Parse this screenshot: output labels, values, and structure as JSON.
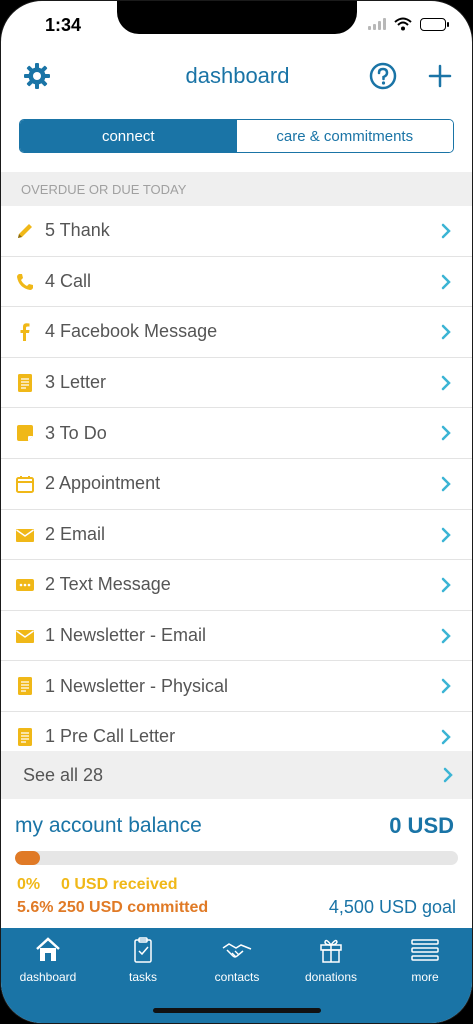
{
  "status_bar": {
    "time": "1:34"
  },
  "header": {
    "title": "dashboard"
  },
  "segments": {
    "connect": "connect",
    "care": "care & commitments"
  },
  "section": {
    "title": "OVERDUE OR DUE TODAY"
  },
  "tasks": [
    {
      "label": "5 Thank",
      "icon": "pencil-icon"
    },
    {
      "label": "4 Call",
      "icon": "phone-icon"
    },
    {
      "label": "4 Facebook Message",
      "icon": "facebook-icon"
    },
    {
      "label": "3 Letter",
      "icon": "letter-icon"
    },
    {
      "label": "3 To Do",
      "icon": "sticky-note-icon"
    },
    {
      "label": "2 Appointment",
      "icon": "calendar-icon"
    },
    {
      "label": "2 Email",
      "icon": "envelope-icon"
    },
    {
      "label": "2 Text Message",
      "icon": "chat-bubble-icon"
    },
    {
      "label": "1 Newsletter - Email",
      "icon": "envelope-icon"
    },
    {
      "label": "1 Newsletter - Physical",
      "icon": "letter-icon"
    },
    {
      "label": "1 Pre Call Letter",
      "icon": "letter-icon"
    }
  ],
  "see_all": {
    "label": "See all 28"
  },
  "balance": {
    "title": "my account balance",
    "amount": "0 USD",
    "received_pct": "0%",
    "received_text": "0 USD received",
    "committed_text": "5.6% 250 USD committed",
    "goal_text": "4,500 USD goal",
    "committed_fraction": 0.056
  },
  "tabs": [
    {
      "label": "dashboard",
      "icon": "home-icon"
    },
    {
      "label": "tasks",
      "icon": "clipboard-icon"
    },
    {
      "label": "contacts",
      "icon": "handshake-icon"
    },
    {
      "label": "donations",
      "icon": "gift-icon"
    },
    {
      "label": "more",
      "icon": "menu-icon"
    }
  ],
  "colors": {
    "brand": "#1a74a6",
    "accent_yellow": "#f0b818",
    "accent_orange": "#e07a26",
    "chevron": "#3bb4d4"
  }
}
